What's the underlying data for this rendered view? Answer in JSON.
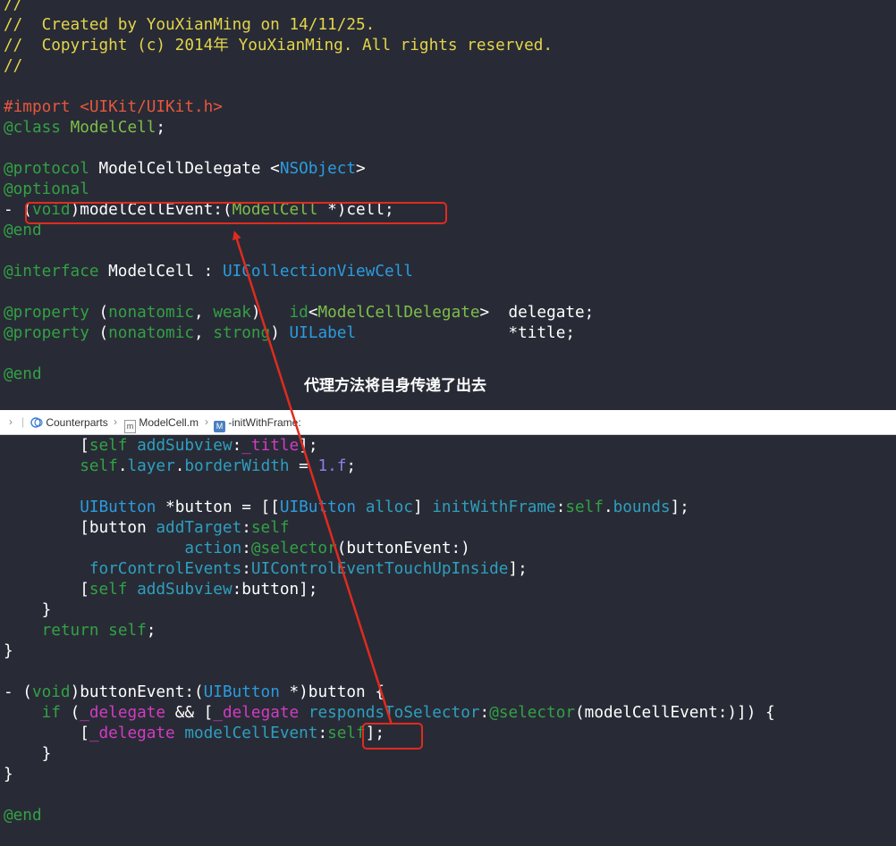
{
  "top_code": {
    "lines": [
      [
        [
          "c-cm",
          "//"
        ]
      ],
      [
        [
          "c-cm",
          "//  Created by YouXianMing on 14/11/25."
        ]
      ],
      [
        [
          "c-cm",
          "//  Copyright (c) 2014年 YouXianMing. All rights reserved."
        ]
      ],
      [
        [
          "c-cm",
          "//"
        ]
      ],
      [],
      [
        [
          "c-pp",
          "#import <UIKit/UIKit.h>"
        ]
      ],
      [
        [
          "c-kw",
          "@class"
        ],
        [
          "c-txt",
          " "
        ],
        [
          "c-grn",
          "ModelCell"
        ],
        [
          "c-txt",
          ";"
        ]
      ],
      [],
      [
        [
          "c-kw",
          "@protocol"
        ],
        [
          "c-txt",
          " ModelCellDelegate <"
        ],
        [
          "c-type",
          "NSObject"
        ],
        [
          "c-txt",
          ">"
        ]
      ],
      [
        [
          "c-kw",
          "@optional"
        ]
      ],
      [
        [
          "c-txt",
          "- ("
        ],
        [
          "c-kw",
          "void"
        ],
        [
          "c-txt",
          ")modelCellEvent:("
        ],
        [
          "c-grn",
          "ModelCell"
        ],
        [
          "c-txt",
          " *)cell;"
        ]
      ],
      [
        [
          "c-kw",
          "@end"
        ]
      ],
      [],
      [
        [
          "c-kw",
          "@interface"
        ],
        [
          "c-txt",
          " ModelCell : "
        ],
        [
          "c-type",
          "UICollectionViewCell"
        ]
      ],
      [],
      [
        [
          "c-kw",
          "@property"
        ],
        [
          "c-txt",
          " ("
        ],
        [
          "c-kw",
          "nonatomic"
        ],
        [
          "c-txt",
          ", "
        ],
        [
          "c-kw",
          "weak"
        ],
        [
          "c-txt",
          ")   "
        ],
        [
          "c-kw",
          "id"
        ],
        [
          "c-txt",
          "<"
        ],
        [
          "c-grn",
          "ModelCellDelegate"
        ],
        [
          "c-txt",
          ">  delegate;"
        ]
      ],
      [
        [
          "c-kw",
          "@property"
        ],
        [
          "c-txt",
          " ("
        ],
        [
          "c-kw",
          "nonatomic"
        ],
        [
          "c-txt",
          ", "
        ],
        [
          "c-kw",
          "strong"
        ],
        [
          "c-txt",
          ") "
        ],
        [
          "c-type",
          "UILabel"
        ],
        [
          "c-txt",
          "                *title;"
        ]
      ],
      [],
      [
        [
          "c-kw",
          "@end"
        ]
      ]
    ]
  },
  "jump_bar": {
    "related_items": "Counterparts",
    "file": "ModelCell.m",
    "file_icon": "m",
    "method_icon": "M",
    "method": "-initWithFrame:"
  },
  "bottom_code": {
    "lines": [
      [
        [
          "c-txt",
          "        ["
        ],
        [
          "c-kw",
          "self"
        ],
        [
          "c-txt",
          " "
        ],
        [
          "c-teal",
          "addSubview"
        ],
        [
          "c-txt",
          ":"
        ],
        [
          "c-mag",
          "_title"
        ],
        [
          "c-txt",
          "];"
        ]
      ],
      [
        [
          "c-txt",
          "        "
        ],
        [
          "c-kw",
          "self"
        ],
        [
          "c-txt",
          "."
        ],
        [
          "c-teal",
          "layer"
        ],
        [
          "c-txt",
          "."
        ],
        [
          "c-teal",
          "borderWidth"
        ],
        [
          "c-txt",
          " = "
        ],
        [
          "c-num",
          "1.f"
        ],
        [
          "c-txt",
          ";"
        ]
      ],
      [],
      [
        [
          "c-txt",
          "        "
        ],
        [
          "c-type",
          "UIButton"
        ],
        [
          "c-txt",
          " *button = [["
        ],
        [
          "c-type",
          "UIButton"
        ],
        [
          "c-txt",
          " "
        ],
        [
          "c-teal",
          "alloc"
        ],
        [
          "c-txt",
          "] "
        ],
        [
          "c-teal",
          "initWithFrame"
        ],
        [
          "c-txt",
          ":"
        ],
        [
          "c-kw",
          "self"
        ],
        [
          "c-txt",
          "."
        ],
        [
          "c-teal",
          "bounds"
        ],
        [
          "c-txt",
          "];"
        ]
      ],
      [
        [
          "c-txt",
          "        [button "
        ],
        [
          "c-teal",
          "addTarget"
        ],
        [
          "c-txt",
          ":"
        ],
        [
          "c-kw",
          "self"
        ]
      ],
      [
        [
          "c-txt",
          "                   "
        ],
        [
          "c-teal",
          "action"
        ],
        [
          "c-txt",
          ":"
        ],
        [
          "c-kw",
          "@selector"
        ],
        [
          "c-txt",
          "(buttonEvent:)"
        ]
      ],
      [
        [
          "c-txt",
          "         "
        ],
        [
          "c-teal",
          "forControlEvents"
        ],
        [
          "c-txt",
          ":"
        ],
        [
          "c-teal",
          "UIControlEventTouchUpInside"
        ],
        [
          "c-txt",
          "];"
        ]
      ],
      [
        [
          "c-txt",
          "        ["
        ],
        [
          "c-kw",
          "self"
        ],
        [
          "c-txt",
          " "
        ],
        [
          "c-teal",
          "addSubview"
        ],
        [
          "c-txt",
          ":button];"
        ]
      ],
      [
        [
          "c-txt",
          "    }"
        ]
      ],
      [
        [
          "c-txt",
          "    "
        ],
        [
          "c-kw",
          "return"
        ],
        [
          "c-txt",
          " "
        ],
        [
          "c-kw",
          "self"
        ],
        [
          "c-txt",
          ";"
        ]
      ],
      [
        [
          "c-txt",
          "}"
        ]
      ],
      [],
      [
        [
          "c-txt",
          "- ("
        ],
        [
          "c-kw",
          "void"
        ],
        [
          "c-txt",
          ")buttonEvent:("
        ],
        [
          "c-type",
          "UIButton"
        ],
        [
          "c-txt",
          " *)button {"
        ]
      ],
      [
        [
          "c-txt",
          "    "
        ],
        [
          "c-kw",
          "if"
        ],
        [
          "c-txt",
          " ("
        ],
        [
          "c-mag",
          "_delegate"
        ],
        [
          "c-txt",
          " && ["
        ],
        [
          "c-mag",
          "_delegate"
        ],
        [
          "c-txt",
          " "
        ],
        [
          "c-teal",
          "respondsToSelector"
        ],
        [
          "c-txt",
          ":"
        ],
        [
          "c-kw",
          "@selector"
        ],
        [
          "c-txt",
          "(modelCellEvent:)]) {"
        ]
      ],
      [
        [
          "c-txt",
          "        ["
        ],
        [
          "c-mag",
          "_delegate"
        ],
        [
          "c-txt",
          " "
        ],
        [
          "c-teal",
          "modelCellEvent"
        ],
        [
          "c-txt",
          ":"
        ],
        [
          "c-kw",
          "self"
        ],
        [
          "c-txt",
          "];"
        ]
      ],
      [
        [
          "c-txt",
          "    }"
        ]
      ],
      [
        [
          "c-txt",
          "}"
        ]
      ],
      [],
      [
        [
          "c-kw",
          "@end"
        ]
      ]
    ]
  },
  "annotation": {
    "text": "代理方法将自身传递了出去",
    "color": "#e02b1f"
  },
  "colors": {
    "background": "#282b35",
    "comment": "#e3d44a",
    "preprocessor": "#e8563e",
    "keyword": "#33a145",
    "type": "#2b9ce0",
    "project_class": "#7dbe4a",
    "number": "#8f7dec",
    "ivar": "#d33bc4",
    "method": "#2e9fc0"
  }
}
